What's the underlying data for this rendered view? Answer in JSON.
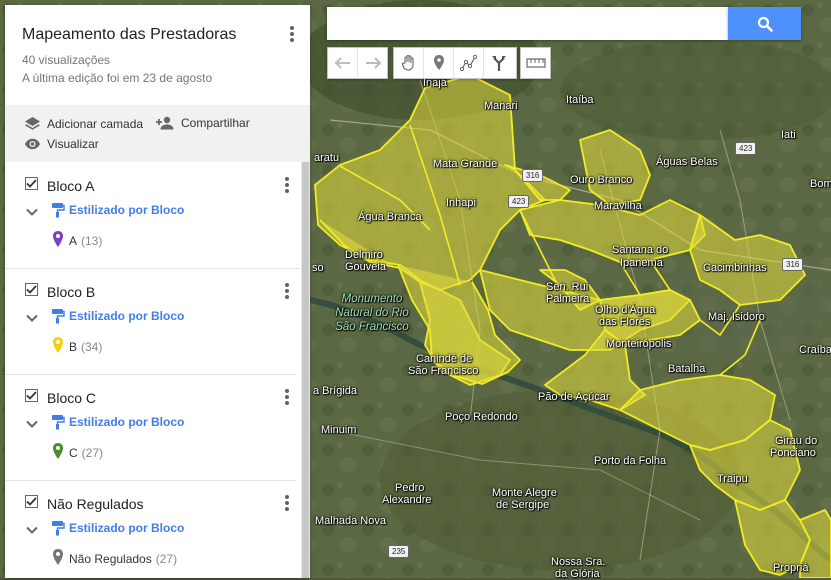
{
  "panel": {
    "title": "Mapeamento das Prestadoras",
    "views": "40 visualizações",
    "last_edit": "A última edição foi em 23 de agosto",
    "actions": {
      "add_layer": "Adicionar camada",
      "share": "Compartilhar",
      "preview": "Visualizar"
    }
  },
  "search": {
    "placeholder": "",
    "value": ""
  },
  "toolbar": {
    "buttons": [
      "undo-icon",
      "redo-icon",
      "hand-icon",
      "marker-icon",
      "draw-line-icon",
      "directions-icon",
      "ruler-icon"
    ]
  },
  "layers": [
    {
      "name": "Bloco A",
      "style": "Estilizado por Bloco",
      "category": "A",
      "count": "(13)",
      "color": "#7b3fc1"
    },
    {
      "name": "Bloco B",
      "style": "Estilizado por Bloco",
      "category": "B",
      "count": "(34)",
      "color": "#f7d10a"
    },
    {
      "name": "Bloco C",
      "style": "Estilizado por Bloco",
      "category": "C",
      "count": "(27)",
      "color": "#4e8a2e"
    },
    {
      "name": "Não Regulados",
      "style": "Estilizado por Bloco",
      "category": "Não Regulados",
      "count": "(27)",
      "color": "#757575"
    }
  ],
  "map": {
    "labels": {
      "inaja": "Inajá",
      "manari": "Manari",
      "itaiba": "Itaíba",
      "iati": "Iati",
      "aratu": "aratu",
      "mata_grande": "Mata Grande",
      "ouro_branco": "Ouro Branco",
      "aguas_belas": "Águas Belas",
      "bom": "Bom",
      "inhapi": "Inhapi",
      "maravilha": "Maravilha",
      "agua_branca": "Água Branca",
      "santana": "Santana do",
      "ipanema": "Ipanema",
      "cacimbinhas": "Cacimbinhas",
      "delmiro": "Delmiro",
      "gouveia": "Gouveia",
      "sen_rui": "Sen. Rui",
      "palmeira": "Palmeira",
      "olho_dagua": "Olho d'Água",
      "das_flores": "das Flores",
      "maj_isidoro": "Maj. Isidoro",
      "monumento": "Monumento Natural do Rio São Francisco",
      "monteiropolis": "Monteirópolis",
      "craiba": "Craíba",
      "caninde": "Canindé de",
      "sao_francisco": "São Francisco",
      "batalha": "Batalha",
      "so": "so",
      "brigida": "a Brígida",
      "pao_de_acucar": "Pão de Açúcar",
      "poco_redondo": "Poço Redondo",
      "minuim": "Minuim",
      "porto_da_folha": "Porto da Folha",
      "girau": "Girau do",
      "ponciano": "Ponciano",
      "traipu": "Traipu",
      "pedro_alexandre_1": "Pedro",
      "pedro_alexandre_2": "Alexandre",
      "monte_alegre_1": "Monte Alegre",
      "monte_alegre_2": "de Sergipe",
      "malhada_nova": "Malhada Nova",
      "nossa_sra_1": "Nossa Sra.",
      "nossa_sra_2": "da Glória",
      "propria": "Propriá",
      "road_316": "316",
      "road_423a": "423",
      "road_423b": "423",
      "road_316b": "316",
      "road_235": "235"
    }
  }
}
